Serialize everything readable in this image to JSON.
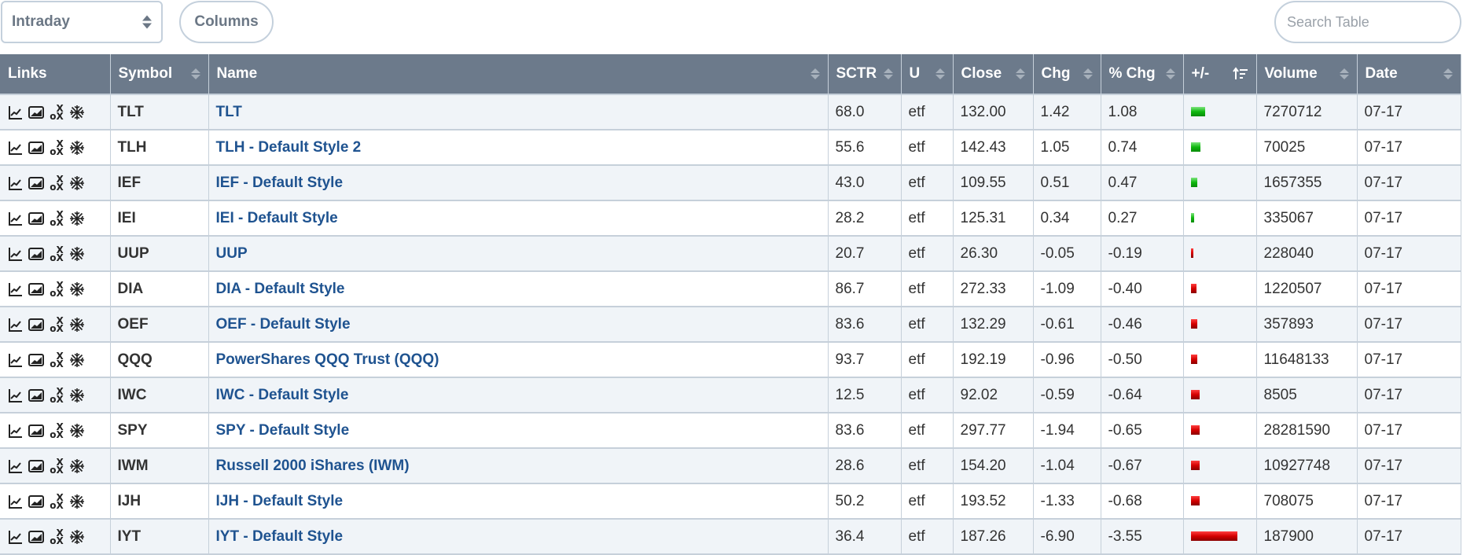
{
  "toolbar": {
    "period_select": {
      "value": "Intraday"
    },
    "columns_label": "Columns",
    "search": {
      "placeholder": "Search Table",
      "value": ""
    }
  },
  "colors": {
    "header_bg": "#6c7a8b",
    "link_text": "#1f5390",
    "positive_bar": "#10b910",
    "negative_bar": "#d40000",
    "row_alt_bg": "#f0f4f8"
  },
  "table": {
    "columns": [
      {
        "key": "links",
        "label": "Links",
        "sortable": false
      },
      {
        "key": "symbol",
        "label": "Symbol",
        "sortable": true
      },
      {
        "key": "name",
        "label": "Name",
        "sortable": true
      },
      {
        "key": "sctr",
        "label": "SCTR",
        "sortable": true
      },
      {
        "key": "u",
        "label": "U",
        "sortable": true
      },
      {
        "key": "close",
        "label": "Close",
        "sortable": true
      },
      {
        "key": "chg",
        "label": "Chg",
        "sortable": true
      },
      {
        "key": "pct_chg",
        "label": "% Chg",
        "sortable": true
      },
      {
        "key": "plus_minus",
        "label": "+/-",
        "sortable": true,
        "sorted": "descending"
      },
      {
        "key": "volume",
        "label": "Volume",
        "sortable": true
      },
      {
        "key": "date",
        "label": "Date",
        "sortable": true
      }
    ],
    "link_icons": [
      "line-chart-icon",
      "area-chart-icon",
      "point-and-figure-icon",
      "seasonality-icon"
    ],
    "rows": [
      {
        "symbol": "TLT",
        "name": "TLT",
        "sctr": "68.0",
        "u": "etf",
        "close": "132.00",
        "chg": "1.42",
        "pct_chg": "1.08",
        "pct_value": 1.08,
        "volume": "7270712",
        "date": "07-17"
      },
      {
        "symbol": "TLH",
        "name": "TLH - Default Style 2",
        "sctr": "55.6",
        "u": "etf",
        "close": "142.43",
        "chg": "1.05",
        "pct_chg": "0.74",
        "pct_value": 0.74,
        "volume": "70025",
        "date": "07-17"
      },
      {
        "symbol": "IEF",
        "name": "IEF - Default Style",
        "sctr": "43.0",
        "u": "etf",
        "close": "109.55",
        "chg": "0.51",
        "pct_chg": "0.47",
        "pct_value": 0.47,
        "volume": "1657355",
        "date": "07-17"
      },
      {
        "symbol": "IEI",
        "name": "IEI - Default Style",
        "sctr": "28.2",
        "u": "etf",
        "close": "125.31",
        "chg": "0.34",
        "pct_chg": "0.27",
        "pct_value": 0.27,
        "volume": "335067",
        "date": "07-17"
      },
      {
        "symbol": "UUP",
        "name": "UUP",
        "sctr": "20.7",
        "u": "etf",
        "close": "26.30",
        "chg": "-0.05",
        "pct_chg": "-0.19",
        "pct_value": -0.19,
        "volume": "228040",
        "date": "07-17"
      },
      {
        "symbol": "DIA",
        "name": "DIA - Default Style",
        "sctr": "86.7",
        "u": "etf",
        "close": "272.33",
        "chg": "-1.09",
        "pct_chg": "-0.40",
        "pct_value": -0.4,
        "volume": "1220507",
        "date": "07-17"
      },
      {
        "symbol": "OEF",
        "name": "OEF - Default Style",
        "sctr": "83.6",
        "u": "etf",
        "close": "132.29",
        "chg": "-0.61",
        "pct_chg": "-0.46",
        "pct_value": -0.46,
        "volume": "357893",
        "date": "07-17"
      },
      {
        "symbol": "QQQ",
        "name": "PowerShares QQQ Trust (QQQ)",
        "sctr": "93.7",
        "u": "etf",
        "close": "192.19",
        "chg": "-0.96",
        "pct_chg": "-0.50",
        "pct_value": -0.5,
        "volume": "11648133",
        "date": "07-17"
      },
      {
        "symbol": "IWC",
        "name": "IWC - Default Style",
        "sctr": "12.5",
        "u": "etf",
        "close": "92.02",
        "chg": "-0.59",
        "pct_chg": "-0.64",
        "pct_value": -0.64,
        "volume": "8505",
        "date": "07-17"
      },
      {
        "symbol": "SPY",
        "name": "SPY - Default Style",
        "sctr": "83.6",
        "u": "etf",
        "close": "297.77",
        "chg": "-1.94",
        "pct_chg": "-0.65",
        "pct_value": -0.65,
        "volume": "28281590",
        "date": "07-17"
      },
      {
        "symbol": "IWM",
        "name": "Russell 2000 iShares (IWM)",
        "sctr": "28.6",
        "u": "etf",
        "close": "154.20",
        "chg": "-1.04",
        "pct_chg": "-0.67",
        "pct_value": -0.67,
        "volume": "10927748",
        "date": "07-17"
      },
      {
        "symbol": "IJH",
        "name": "IJH - Default Style",
        "sctr": "50.2",
        "u": "etf",
        "close": "193.52",
        "chg": "-1.33",
        "pct_chg": "-0.68",
        "pct_value": -0.68,
        "volume": "708075",
        "date": "07-17"
      },
      {
        "symbol": "IYT",
        "name": "IYT - Default Style",
        "sctr": "36.4",
        "u": "etf",
        "close": "187.26",
        "chg": "-6.90",
        "pct_chg": "-3.55",
        "pct_value": -3.55,
        "volume": "187900",
        "date": "07-17"
      }
    ]
  }
}
